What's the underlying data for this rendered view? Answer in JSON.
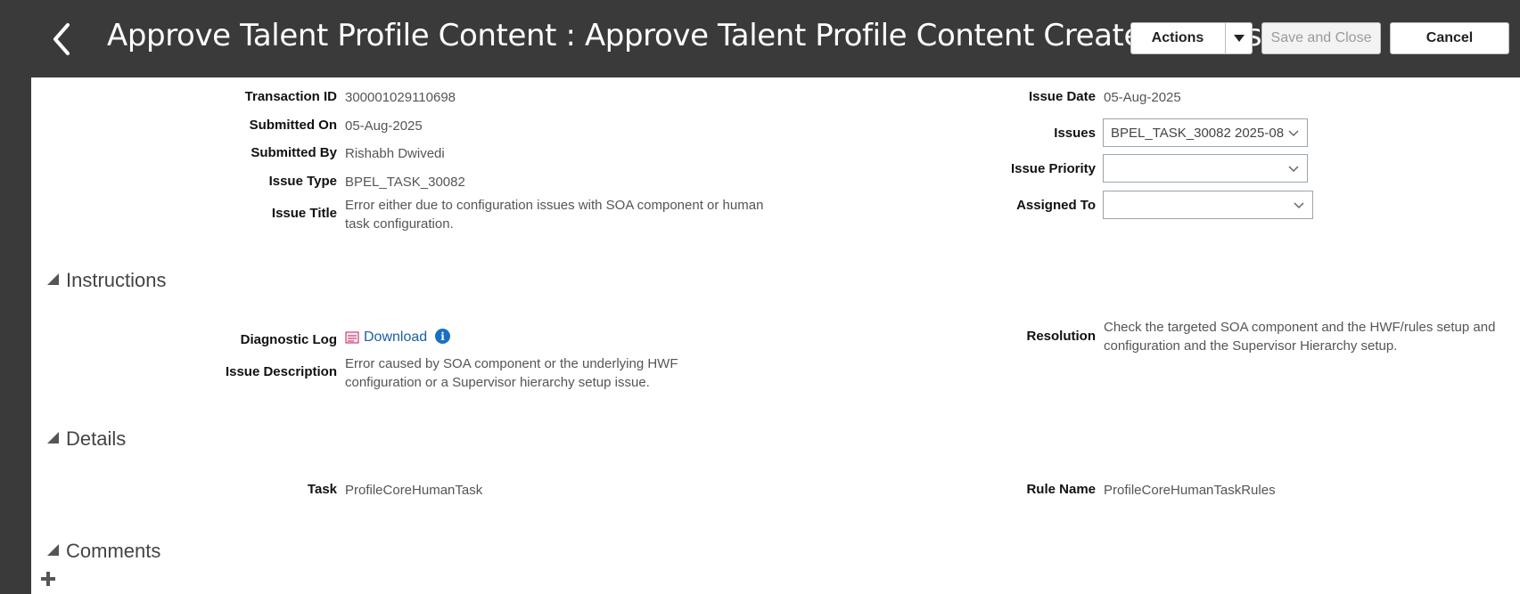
{
  "header": {
    "title": "Approve Talent Profile Content : Approve Talent Profile Content Created By Ris...",
    "actions_label": "Actions",
    "save_close_label": "Save and Close",
    "cancel_label": "Cancel"
  },
  "fields_left": {
    "transaction_id_label": "Transaction ID",
    "transaction_id_value": "300001029110698",
    "submitted_on_label": "Submitted On",
    "submitted_on_value": "05-Aug-2025",
    "submitted_by_label": "Submitted By",
    "submitted_by_value": "Rishabh Dwivedi",
    "issue_type_label": "Issue Type",
    "issue_type_value": "BPEL_TASK_30082",
    "issue_title_label": "Issue Title",
    "issue_title_value": "Error either due to configuration issues with SOA component or human task configuration."
  },
  "fields_right": {
    "issue_date_label": "Issue Date",
    "issue_date_value": "05-Aug-2025",
    "issues_label": "Issues",
    "issues_value": "BPEL_TASK_30082 2025-08",
    "issue_priority_label": "Issue Priority",
    "issue_priority_value": "",
    "assigned_to_label": "Assigned To",
    "assigned_to_value": ""
  },
  "instructions": {
    "section_title": "Instructions",
    "diagnostic_log_label": "Diagnostic Log",
    "download_label": "Download",
    "issue_description_label": "Issue Description",
    "issue_description_value": "Error caused by SOA component or the underlying HWF configuration or a Supervisor hierarchy setup issue.",
    "resolution_label": "Resolution",
    "resolution_value": "Check the targeted SOA component and the HWF/rules setup and configuration and the Supervisor Hierarchy setup."
  },
  "details": {
    "section_title": "Details",
    "task_label": "Task",
    "task_value": "ProfileCoreHumanTask",
    "rule_name_label": "Rule Name",
    "rule_name_value": "ProfileCoreHumanTaskRules"
  },
  "comments": {
    "section_title": "Comments"
  },
  "icons": {
    "back": "chevron-left-icon",
    "dropdown": "caret-down-icon",
    "log_file": "log-file-icon",
    "info": "info-icon",
    "add": "plus-icon"
  }
}
